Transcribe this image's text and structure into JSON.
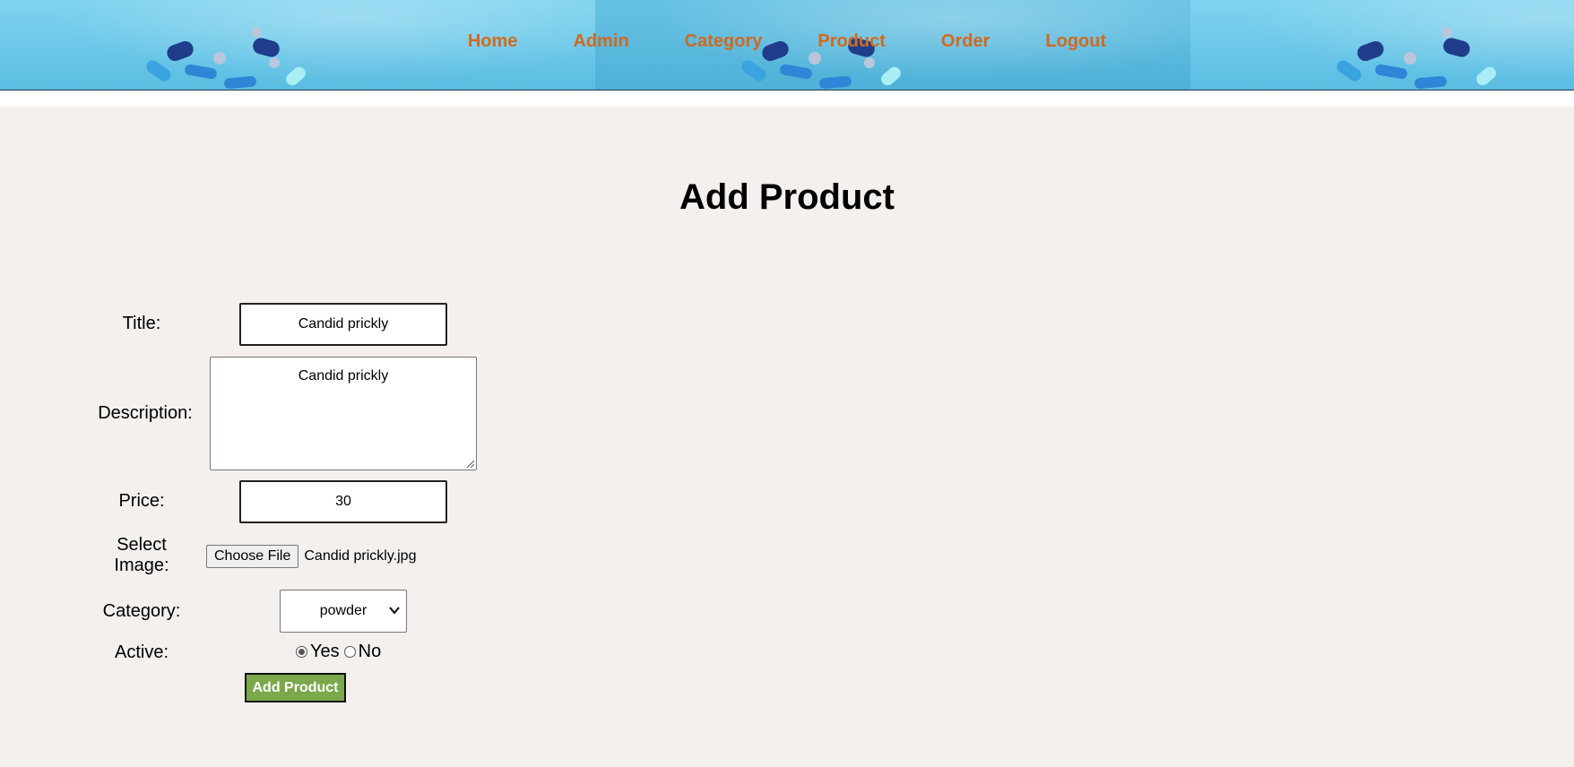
{
  "nav": {
    "items": [
      "Home",
      "Admin",
      "Category",
      "Product",
      "Order",
      "Logout"
    ],
    "link_color": "#d2691e"
  },
  "header": {
    "banner_color": "#6bc7e8"
  },
  "page": {
    "title": "Add Product"
  },
  "form": {
    "title_label": "Title:",
    "title_value": "Candid prickly",
    "description_label": "Description:",
    "description_value": "Candid prickly",
    "price_label": "Price:",
    "price_value": "30",
    "image_label_line1": "Select",
    "image_label_line2": "Image:",
    "choose_file_label": "Choose File",
    "file_name": "Candid prickly.jpg",
    "category_label": "Category:",
    "category_selected": "powder",
    "active_label": "Active:",
    "active_yes": "Yes",
    "active_no": "No",
    "active_selected": "Yes",
    "submit_label": "Add Product",
    "submit_color": "#7aa84a"
  },
  "colors": {
    "page_bg": "#f3f0ed"
  }
}
